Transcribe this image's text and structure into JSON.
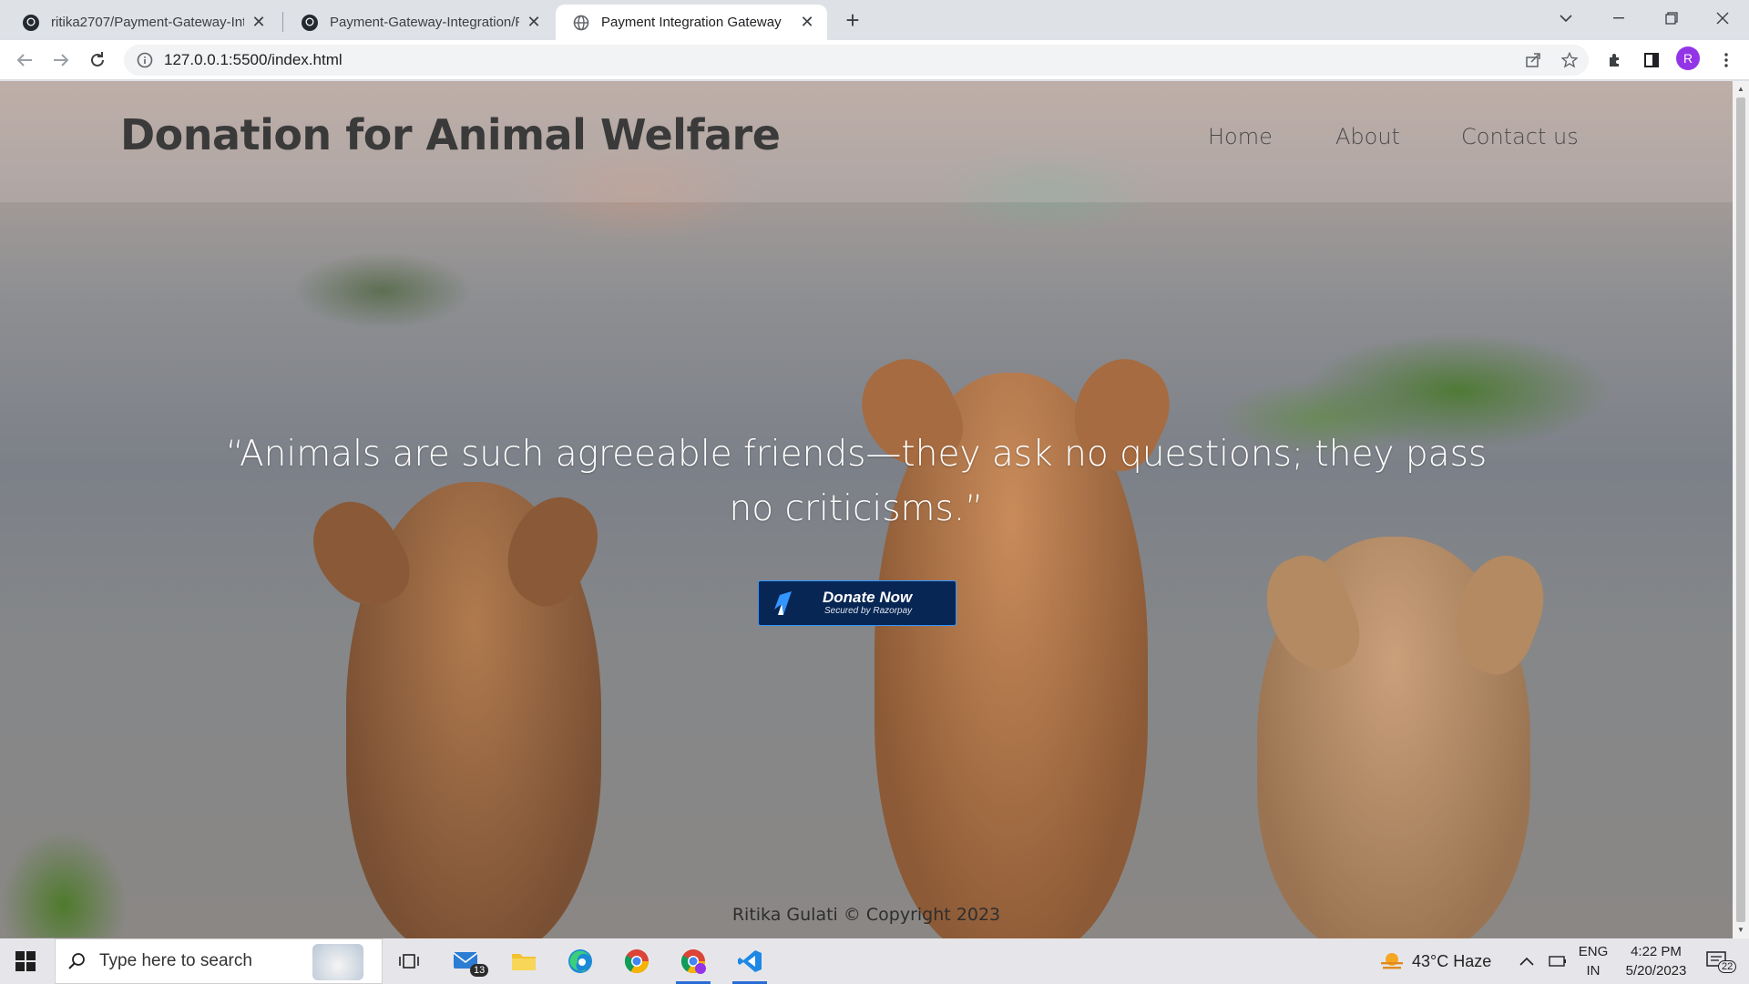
{
  "browser": {
    "tabs": [
      {
        "title": "ritika2707/Payment-Gateway-Inte",
        "active": false
      },
      {
        "title": "Payment-Gateway-Integration/RE",
        "active": false
      },
      {
        "title": "Payment Integration Gateway",
        "active": true
      }
    ],
    "url": "127.0.0.1:5500/index.html",
    "profile_initial": "R"
  },
  "page": {
    "brand": "Donation for Animal Welfare",
    "nav": [
      "Home",
      "About",
      "Contact us"
    ],
    "quote": "“Animals are such agreeable friends—they ask no questions; they pass no criticisms.”",
    "donate_button": {
      "label": "Donate Now",
      "sub_label": "Secured by Razorpay"
    },
    "footer": "Ritika Gulati © Copyright 2023"
  },
  "taskbar": {
    "search_placeholder": "Type here to search",
    "mail_badge": "13",
    "weather": "43°C  Haze",
    "lang_top": "ENG",
    "lang_bottom": "IN",
    "time": "4:22 PM",
    "date": "5/20/2023",
    "notification_count": "22"
  },
  "colors": {
    "razorpay_blue": "#072654",
    "razorpay_accent": "#3395ff",
    "taskbar_active": "#2a6cd6"
  }
}
